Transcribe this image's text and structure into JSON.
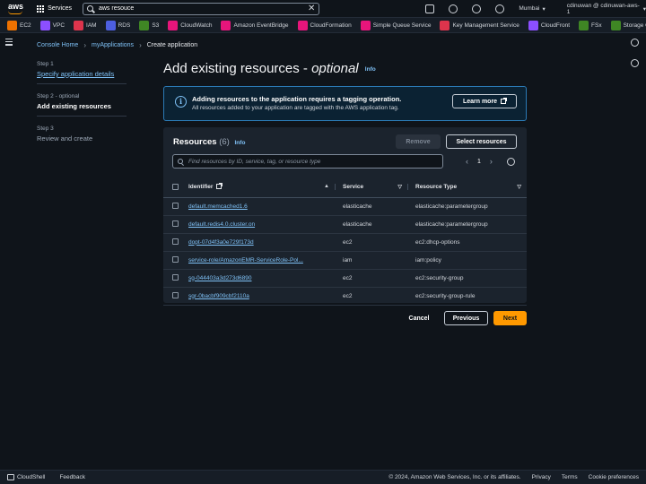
{
  "topnav": {
    "services_label": "Services",
    "search_value": "aws resouce",
    "region": "Mumbai",
    "account": "cdinuwan @ cdinuwan-aws-1"
  },
  "favorites": [
    {
      "label": "EC2",
      "color": "#ed7100"
    },
    {
      "label": "VPC",
      "color": "#8c4fff"
    },
    {
      "label": "IAM",
      "color": "#dd344c"
    },
    {
      "label": "RDS",
      "color": "#4d5fe0"
    },
    {
      "label": "S3",
      "color": "#3f8624"
    },
    {
      "label": "CloudWatch",
      "color": "#e7157b"
    },
    {
      "label": "Amazon EventBridge",
      "color": "#e7157b"
    },
    {
      "label": "CloudFormation",
      "color": "#e7157b"
    },
    {
      "label": "Simple Queue Service",
      "color": "#e7157b"
    },
    {
      "label": "Key Management Service",
      "color": "#dd344c"
    },
    {
      "label": "CloudFront",
      "color": "#8c4fff"
    },
    {
      "label": "FSx",
      "color": "#3f8624"
    },
    {
      "label": "Storage Gateway",
      "color": "#3f8624"
    }
  ],
  "breadcrumb": {
    "home": "Console Home",
    "apps": "myApplications",
    "current": "Create application"
  },
  "steps": [
    {
      "label": "Step 1",
      "name": "Specify application details"
    },
    {
      "label": "Step 2 - optional",
      "name": "Add existing resources"
    },
    {
      "label": "Step 3",
      "name": "Review and create"
    }
  ],
  "page": {
    "title_main": "Add existing resources - ",
    "title_em": "optional",
    "info": "Info"
  },
  "alert": {
    "title": "Adding resources to the application requires a tagging operation.",
    "body": "All resources added to your application are tagged with the AWS application tag.",
    "learn_more": "Learn more"
  },
  "resources": {
    "title": "Resources",
    "count": "(6)",
    "info": "Info",
    "remove": "Remove",
    "select": "Select resources",
    "search_placeholder": "Find resources by ID, service, tag, or resource type",
    "page": "1",
    "columns": {
      "identifier": "Identifier",
      "service": "Service",
      "type": "Resource Type"
    },
    "rows": [
      {
        "id": "default.memcached1.6",
        "service": "elasticache",
        "type": "elasticache:parametergroup"
      },
      {
        "id": "default.redis4.0.cluster.on",
        "service": "elasticache",
        "type": "elasticache:parametergroup"
      },
      {
        "id": "dopt-07d4f3a0e729f173d",
        "service": "ec2",
        "type": "ec2:dhcp-options"
      },
      {
        "id": "service-role/AmazonEMR-ServiceRole-Pol...",
        "service": "iam",
        "type": "iam:policy"
      },
      {
        "id": "sg-044403a3d273d6890",
        "service": "ec2",
        "type": "ec2:security-group"
      },
      {
        "id": "sgr-0bacbf909cbf2110a",
        "service": "ec2",
        "type": "ec2:security-group-rule"
      }
    ]
  },
  "actions": {
    "cancel": "Cancel",
    "previous": "Previous",
    "next": "Next"
  },
  "footer": {
    "cloudshell": "CloudShell",
    "feedback": "Feedback",
    "copyright": "© 2024, Amazon Web Services, Inc. or its affiliates.",
    "privacy": "Privacy",
    "terms": "Terms",
    "cookies": "Cookie preferences"
  }
}
